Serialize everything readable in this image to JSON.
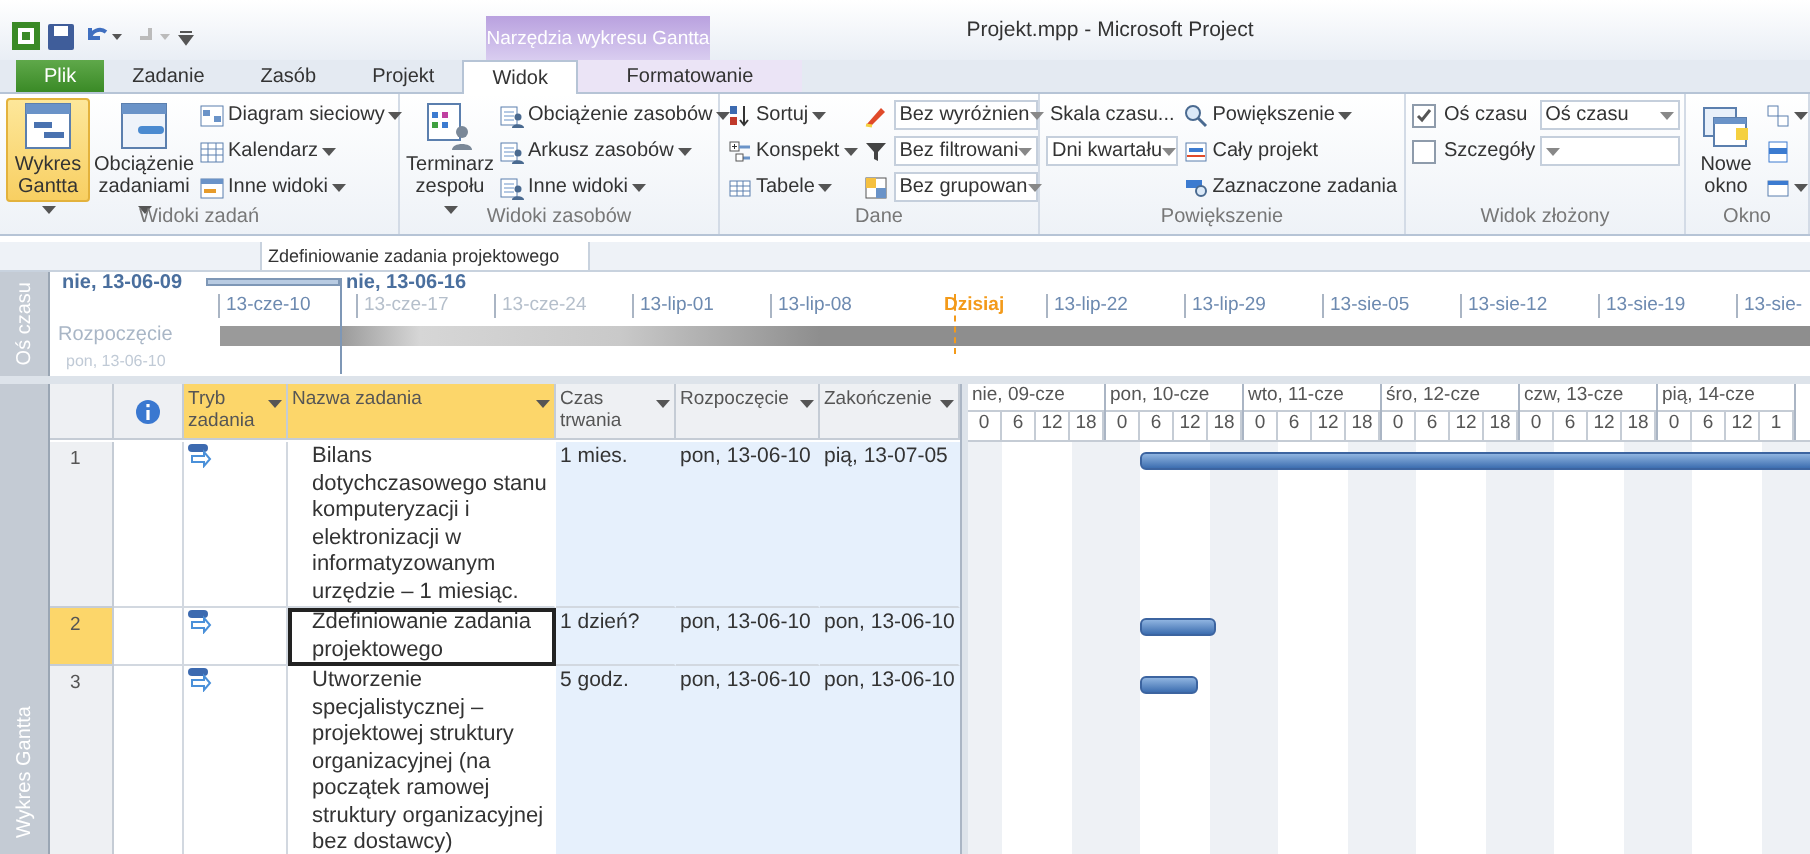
{
  "window": {
    "title": "Projekt.mpp - Microsoft Project",
    "context_header": "Narzędzia wykresu Gantta"
  },
  "tabs": [
    {
      "label": "Plik",
      "kind": "file",
      "selected": false
    },
    {
      "label": "Zadanie",
      "kind": "normal",
      "selected": false
    },
    {
      "label": "Zasób",
      "kind": "normal",
      "selected": false
    },
    {
      "label": "Projekt",
      "kind": "normal",
      "selected": false
    },
    {
      "label": "Widok",
      "kind": "normal",
      "selected": true
    },
    {
      "label": "Formatowanie",
      "kind": "contextual",
      "selected": false
    }
  ],
  "ribbon": [
    {
      "label": "Widoki zadań",
      "columns": [
        [
          {
            "kind": "large",
            "label": "Wykres Gantta",
            "menu": true,
            "selected": true
          }
        ],
        [
          {
            "kind": "large",
            "label": "Obciążenie zadaniami",
            "menu": true,
            "selected": false
          }
        ],
        [
          {
            "kind": "small",
            "label": "Diagram sieciowy",
            "menu": true
          },
          {
            "kind": "small",
            "label": "Kalendarz",
            "menu": true
          },
          {
            "kind": "small",
            "label": "Inne widoki",
            "menu": true
          }
        ]
      ]
    },
    {
      "label": "Widoki zasobów",
      "columns": [
        [
          {
            "kind": "large",
            "label": "Terminarz zespołu",
            "menu": true,
            "selected": false
          }
        ],
        [
          {
            "kind": "small",
            "label": "Obciążenie zasobów",
            "menu": true
          },
          {
            "kind": "small",
            "label": "Arkusz zasobów",
            "menu": true
          },
          {
            "kind": "small",
            "label": "Inne widoki",
            "menu": true
          }
        ]
      ]
    },
    {
      "label": "Dane",
      "columns": [
        [
          {
            "kind": "small",
            "label": "Sortuj",
            "menu": true
          },
          {
            "kind": "small",
            "label": "Konspekt",
            "menu": true
          },
          {
            "kind": "small",
            "label": "Tabele",
            "menu": true
          }
        ],
        [
          {
            "kind": "select",
            "value": "Bez wyróżnien"
          },
          {
            "kind": "select",
            "value": "Bez filtrowani"
          },
          {
            "kind": "select",
            "value": "Bez grupowan"
          }
        ]
      ]
    },
    {
      "label": "Powiększenie",
      "columns": [
        [
          {
            "kind": "label",
            "label": "Skala czasu..."
          },
          {
            "kind": "select",
            "value": "Dni kwartału"
          }
        ],
        [
          {
            "kind": "small",
            "label": "Powiększenie",
            "menu": true
          },
          {
            "kind": "small",
            "label": "Cały projekt",
            "menu": false
          },
          {
            "kind": "small",
            "label": "Zaznaczone zadania",
            "menu": false
          }
        ]
      ]
    },
    {
      "label": "Widok złożony",
      "columns": [
        [
          {
            "kind": "checkbox",
            "label": "Oś czasu",
            "checked": true
          },
          {
            "kind": "checkbox",
            "label": "Szczegóły",
            "checked": false
          }
        ],
        [
          {
            "kind": "select",
            "value": "Oś czasu"
          },
          {
            "kind": "select"
          }
        ]
      ]
    },
    {
      "label": "Okno",
      "columns": [
        [
          {
            "kind": "large",
            "label": "Nowe okno",
            "menu": false,
            "selected": false
          }
        ],
        [
          {
            "kind": "icon",
            "menu": true
          },
          {
            "kind": "icon",
            "menu": false
          },
          {
            "kind": "icon",
            "menu": true
          }
        ]
      ]
    }
  ],
  "entry_bar": {
    "value": "Zdefiniowanie zadania projektowego"
  },
  "timeline": {
    "side_label": "Oś czasu",
    "range_start": "nie, 13-06-09",
    "range_end": "nie, 13-06-16",
    "start_label": "Rozpoczęcie",
    "start_date": "pon, 13-06-10",
    "ticks": [
      {
        "label": "13-cze-10",
        "kind": "date"
      },
      {
        "label": "13-cze-17",
        "kind": "date"
      },
      {
        "label": "13-cze-24",
        "kind": "date"
      },
      {
        "label": "13-lip-01",
        "kind": "date"
      },
      {
        "label": "13-lip-08",
        "kind": "date"
      },
      {
        "label": "Dzisiaj",
        "kind": "today"
      },
      {
        "label": "13-lip-22",
        "kind": "date"
      },
      {
        "label": "13-lip-29",
        "kind": "date"
      },
      {
        "label": "13-sie-05",
        "kind": "date"
      },
      {
        "label": "13-sie-12",
        "kind": "date"
      },
      {
        "label": "13-sie-19",
        "kind": "date"
      },
      {
        "label": "13-sie-",
        "kind": "date"
      }
    ]
  },
  "view_label": "Wykres Gantta",
  "table": {
    "columns": [
      {
        "kind": "rowhead",
        "highlighted": false
      },
      {
        "kind": "info",
        "highlighted": false
      },
      {
        "label": "Tryb zadania",
        "kind": "text",
        "highlighted": true
      },
      {
        "label": "Nazwa zadania",
        "kind": "text",
        "highlighted": true
      },
      {
        "label": "Czas trwania",
        "kind": "text",
        "highlighted": false
      },
      {
        "label": "Rozpoczęcie",
        "kind": "text",
        "highlighted": false
      },
      {
        "label": "Zakończenie",
        "kind": "text",
        "highlighted": false
      }
    ],
    "rows": [
      {
        "id": "1",
        "selected": false,
        "auto_scheduled": true,
        "name": "Bilans dotychczasowego stanu komputeryzacji i elektronizacji w informatyzowanym urzędzie – 1 miesiąc.",
        "duration": "1 mies.",
        "start": "pon, 13-06-10",
        "finish": "pią, 13-07-05",
        "bar": {
          "kind": "month"
        }
      },
      {
        "id": "2",
        "selected": true,
        "auto_scheduled": true,
        "name": "Zdefiniowanie zadania projektowego",
        "duration": "1 dzień?",
        "start": "pon, 13-06-10",
        "finish": "pon, 13-06-10",
        "bar": {
          "kind": "day"
        }
      },
      {
        "id": "3",
        "selected": false,
        "auto_scheduled": true,
        "name": "Utworzenie specjalistycznej – projektowej struktury organizacyjnej (na początek ramowej struktury organizacyjnej bez dostawcy)",
        "duration": "5 godz.",
        "start": "pon, 13-06-10",
        "finish": "pon, 13-06-10",
        "bar": {
          "kind": "hours"
        }
      }
    ]
  },
  "gantt_scale": [
    {
      "day": "nie, 09-cze",
      "hours": [
        "0",
        "6",
        "12",
        "18"
      ]
    },
    {
      "day": "pon, 10-cze",
      "hours": [
        "0",
        "6",
        "12",
        "18"
      ]
    },
    {
      "day": "wto, 11-cze",
      "hours": [
        "0",
        "6",
        "12",
        "18"
      ]
    },
    {
      "day": "śro, 12-cze",
      "hours": [
        "0",
        "6",
        "12",
        "18"
      ]
    },
    {
      "day": "czw, 13-cze",
      "hours": [
        "0",
        "6",
        "12",
        "18"
      ]
    },
    {
      "day": "pią, 14-cze",
      "hours": [
        "0",
        "6",
        "12",
        "1"
      ]
    }
  ]
}
